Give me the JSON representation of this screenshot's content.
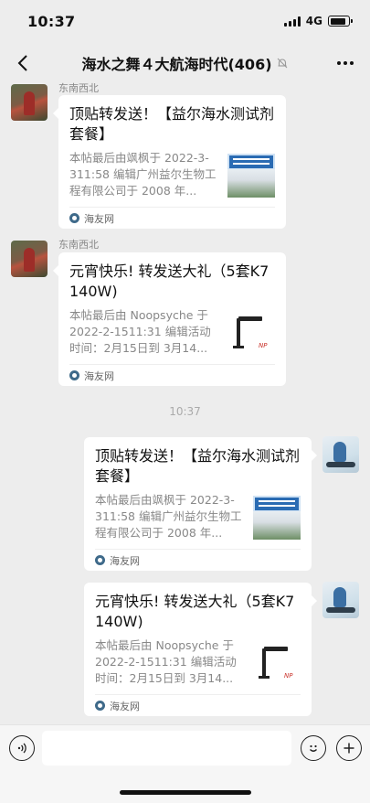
{
  "status_bar": {
    "time": "10:37",
    "network": "4G",
    "battery_level": 0.85
  },
  "nav": {
    "title": "海水之舞４大航海时代(406)",
    "icons": [
      "chevron-left-icon",
      "mute-bell-icon",
      "more-icon"
    ]
  },
  "messages": [
    {
      "side": "left",
      "sender": "东南西北",
      "title": "顶贴转发送！【益尔海水测试剂套餐】",
      "description": "本帖最后由飒枫于 2022-3-311:58 编辑广州益尔生物工程有限公司于 2008 年...",
      "source": "海友网",
      "thumbnail": "building-photo"
    },
    {
      "side": "left",
      "sender": "东南西北",
      "title": "元宵快乐! 转发送大礼（5套K7  140W)",
      "description": "本帖最后由 Noopsyche 于 2022-2-1511:31 编辑活动时间：2月15日到 3月14...",
      "source": "海友网",
      "thumbnail": "aquarium-lamp-photo"
    },
    {
      "side": "right",
      "title": "顶贴转发送！【益尔海水测试剂套餐】",
      "description": "本帖最后由飒枫于 2022-3-311:58 编辑广州益尔生物工程有限公司于 2008 年...",
      "source": "海友网",
      "thumbnail": "building-photo"
    },
    {
      "side": "right",
      "title": "元宵快乐! 转发送大礼（5套K7  140W)",
      "description": "本帖最后由 Noopsyche 于 2022-2-1511:31 编辑活动时间：2月15日到 3月14...",
      "source": "海友网",
      "thumbnail": "aquarium-lamp-photo"
    }
  ],
  "timestamp": "10:37",
  "input_bar": {
    "icons": [
      "voice-icon",
      "emoji-icon",
      "plus-icon"
    ]
  },
  "colors": {
    "background": "#ededed",
    "card": "#ffffff",
    "muted_text": "#888888"
  }
}
